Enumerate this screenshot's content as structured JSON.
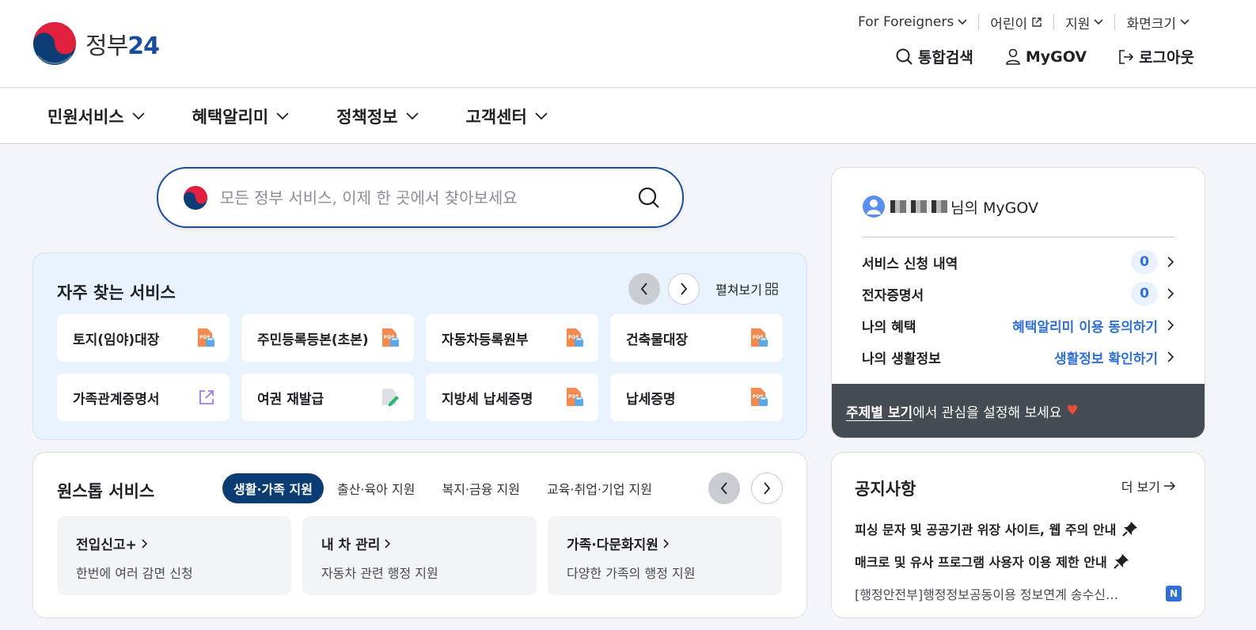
{
  "header": {
    "logo_text": "정부",
    "logo_num": "24",
    "util_links": [
      {
        "label": "For Foreigners",
        "icon": "chevron-down-icon"
      },
      {
        "label": "어린이",
        "icon": "external-link-icon"
      },
      {
        "label": "지원",
        "icon": "chevron-down-icon"
      },
      {
        "label": "화면크기",
        "icon": "chevron-down-icon"
      }
    ],
    "actions": {
      "search": "통합검색",
      "mygov": "MyGOV",
      "logout": "로그아웃"
    }
  },
  "nav": {
    "items": [
      "민원서비스",
      "혜택알리미",
      "정책정보",
      "고객센터"
    ]
  },
  "search": {
    "placeholder": "모든 정부 서비스, 이제 한 곳에서 찾아보세요"
  },
  "frequent": {
    "title": "자주 찾는 서비스",
    "expand_label": "펼쳐보기",
    "cards": [
      {
        "label": "토지(임야)대장",
        "icon": "pdf-doc-icon"
      },
      {
        "label": "주민등록등본(초본)",
        "icon": "pdf-doc-icon"
      },
      {
        "label": "자동차등록원부",
        "icon": "pdf-doc-icon"
      },
      {
        "label": "건축물대장",
        "icon": "pdf-doc-icon"
      },
      {
        "label": "가족관계증명서",
        "icon": "external-link-icon"
      },
      {
        "label": "여권 재발급",
        "icon": "edit-doc-icon"
      },
      {
        "label": "지방세 납세증명",
        "icon": "pdf-doc-icon"
      },
      {
        "label": "납세증명",
        "icon": "pdf-doc-icon"
      }
    ]
  },
  "onestop": {
    "title": "원스톱 서비스",
    "tabs": [
      "생활·가족 지원",
      "출산·육아 지원",
      "복지·금융 지원",
      "교육·취업·기업 지원"
    ],
    "cards": [
      {
        "title": "전입신고+",
        "desc": "한번에 여러 감면 신청"
      },
      {
        "title": "내 차 관리",
        "desc": "자동차 관련 행정 지원"
      },
      {
        "title": "가족·다문화지원",
        "desc": "다양한 가족의 행정 지원"
      }
    ]
  },
  "mygov": {
    "suffix": "님의 MyGOV",
    "rows": [
      {
        "label": "서비스 신청 내역",
        "value": "0"
      },
      {
        "label": "전자증명서",
        "value": "0"
      },
      {
        "label": "나의 혜택",
        "link": "혜택알리미 이용 동의하기"
      },
      {
        "label": "나의 생활정보",
        "link": "생활정보 확인하기"
      }
    ],
    "footer_link": "주제별 보기",
    "footer_text": "에서 관심을 설정해 보세요"
  },
  "notice": {
    "title": "공지사항",
    "more": "더 보기",
    "items": [
      {
        "text": "피싱 문자 및 공공기관 위장 사이트, 웹 주의 안내"
      },
      {
        "text": "매크로 및 유사 프로그램 사용자 이용 제한 안내"
      },
      {
        "text": "[행정안전부]행정정보공동이용 정보연계 송수신…",
        "badge": "N"
      }
    ]
  },
  "colors": {
    "brand_blue": "#1a4d9c",
    "tab_active": "#0b3c73",
    "link_blue": "#2f6fd6",
    "footer_dark": "#464c53"
  }
}
